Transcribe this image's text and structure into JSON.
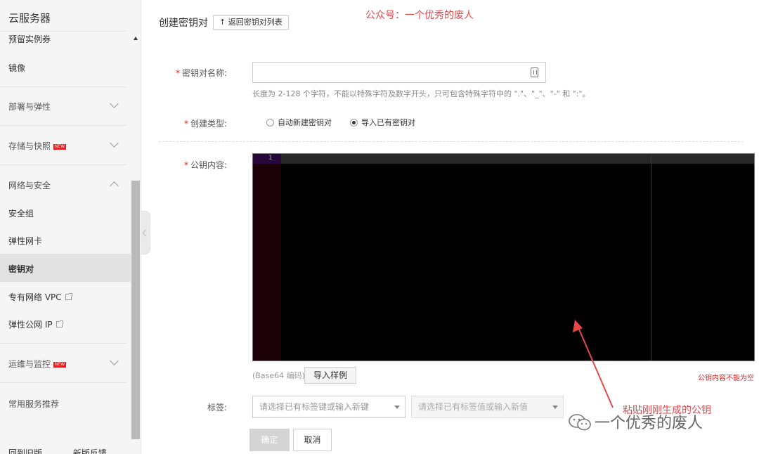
{
  "sidebar": {
    "title": "云服务器",
    "items": [
      {
        "label": "预留实例券"
      },
      {
        "label": "镜像"
      },
      {
        "label": "部署与弹性"
      },
      {
        "label": "存储与快照",
        "badge": "NEW"
      },
      {
        "label": "网络与安全"
      },
      {
        "label": "安全组"
      },
      {
        "label": "弹性网卡"
      },
      {
        "label": "密钥对"
      },
      {
        "label": "专有网络 VPC"
      },
      {
        "label": "弹性公网 IP"
      },
      {
        "label": "运维与监控",
        "badge": "NEW"
      },
      {
        "label": "常用服务推荐"
      }
    ],
    "footer": {
      "back_old": "回到旧版",
      "feedback": "新版反馈"
    }
  },
  "header": {
    "title": "创建密钥对",
    "back_label": "返回密钥对列表",
    "watermark": "公众号：一个优秀的废人"
  },
  "form": {
    "name_label": "密钥对名称:",
    "name_value": "",
    "name_hint": "长度为 2-128 个字符，不能以特殊字符及数字开头，只可包含特殊字符中的 \".\"、\"_\"、\"-\" 和 \":\"。",
    "type_label": "创建类型:",
    "type_options": [
      "自动新建密钥对",
      "导入已有密钥对"
    ],
    "type_selected": "导入已有密钥对",
    "pubkey_label": "公钥内容:",
    "editor_line": "1",
    "encoding_note": "(Base64 编码)",
    "import_sample": "导入样例",
    "error": "公钥内容不能为空",
    "tags_label": "标签:",
    "tag_key_placeholder": "请选择已有标签键或输入新键",
    "tag_value_placeholder": "请选择已有标签值或输入新值",
    "ok": "确定",
    "cancel": "取消"
  },
  "annotations": {
    "paste_note": "粘贴刚刚生成的公钥",
    "watermark_bottom": "一个优秀的废人"
  },
  "colors": {
    "accent_red": "#e8474a",
    "required_red": "#e02020",
    "editor_bg": "#000000"
  }
}
